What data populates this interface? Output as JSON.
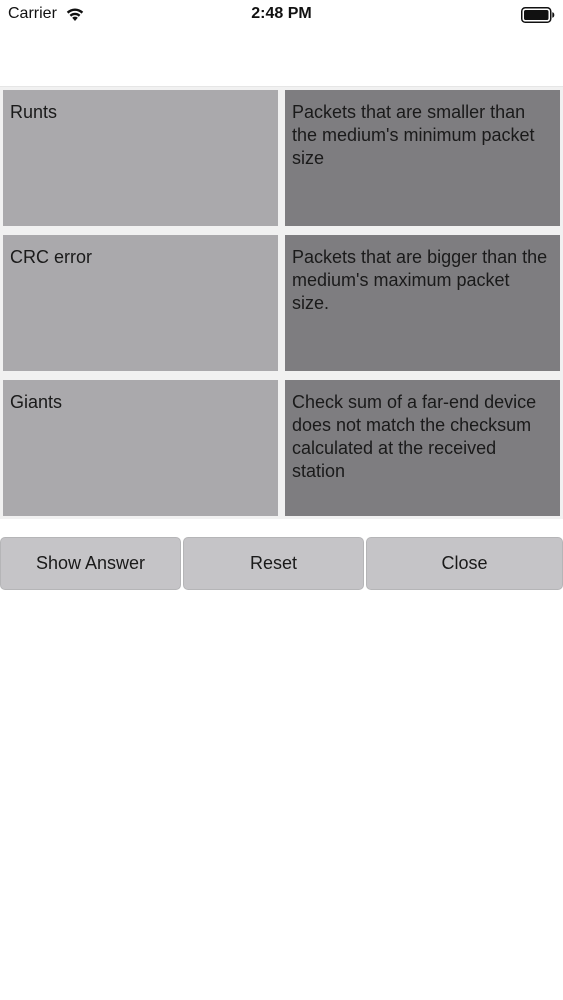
{
  "status_bar": {
    "carrier": "Carrier",
    "time": "2:48 PM"
  },
  "rows": [
    {
      "term": "Runts",
      "definition": "Packets that are smaller than the medium's minimum packet size"
    },
    {
      "term": "CRC error",
      "definition": "Packets that are bigger than the medium's maximum packet size."
    },
    {
      "term": "Giants",
      "definition": "Check sum of a far-end device does not match the checksum calculated at the received station"
    }
  ],
  "buttons": {
    "show_answer": "Show Answer",
    "reset": "Reset",
    "close": "Close"
  },
  "colors": {
    "term_cell": "#aaa9ac",
    "definition_cell": "#7e7d80",
    "button": "#c5c4c7"
  }
}
